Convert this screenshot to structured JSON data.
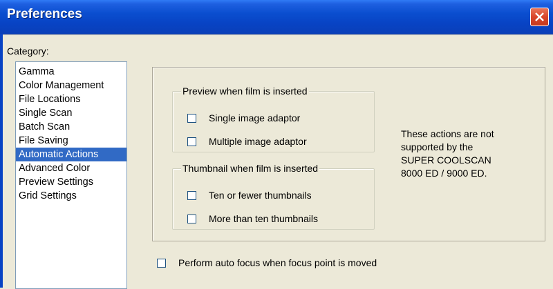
{
  "window": {
    "title": "Preferences"
  },
  "category": {
    "label": "Category:",
    "items": [
      "Gamma",
      "Color Management",
      "File Locations",
      "Single Scan",
      "Batch Scan",
      "File Saving",
      "Automatic Actions",
      "Advanced Color",
      "Preview Settings",
      "Grid Settings"
    ],
    "selected": "Automatic Actions"
  },
  "preview_group": {
    "legend": "Preview when film is inserted",
    "options": [
      {
        "label": "Single image adaptor",
        "checked": false
      },
      {
        "label": "Multiple image adaptor",
        "checked": false
      }
    ]
  },
  "thumbnail_group": {
    "legend": "Thumbnail when film is inserted",
    "options": [
      {
        "label": "Ten or fewer thumbnails",
        "checked": false
      },
      {
        "label": "More than ten thumbnails",
        "checked": false
      }
    ]
  },
  "note": {
    "line1": "These actions are not",
    "line2": "supported by the",
    "line3": "SUPER COOLSCAN",
    "line4": "8000 ED / 9000 ED."
  },
  "auto_focus": {
    "label": "Perform auto focus when focus point is moved",
    "checked": false
  },
  "colors": {
    "titlebar": "#0a4ecf",
    "selection": "#316ac5",
    "close_button": "#d9462b",
    "dialog_background": "#ece9d8"
  }
}
